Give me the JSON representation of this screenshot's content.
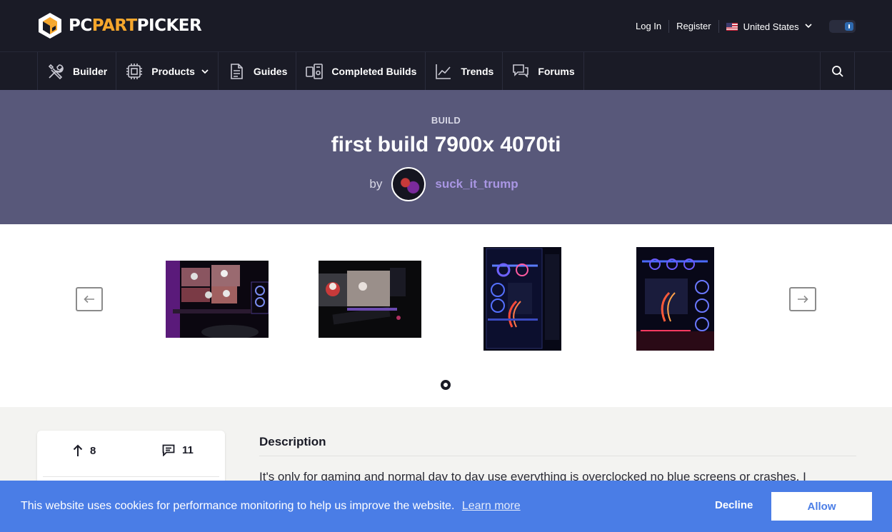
{
  "header": {
    "logo_prefix": "PC",
    "logo_accent": "PART",
    "logo_suffix": "PICKER",
    "login": "Log In",
    "register": "Register",
    "country": "United States"
  },
  "nav": {
    "items": [
      {
        "label": "Builder",
        "icon": "builder-tools-icon"
      },
      {
        "label": "Products",
        "icon": "cpu-chip-icon",
        "has_dropdown": true
      },
      {
        "label": "Guides",
        "icon": "document-icon"
      },
      {
        "label": "Completed Builds",
        "icon": "completed-builds-icon"
      },
      {
        "label": "Trends",
        "icon": "trend-chart-icon"
      },
      {
        "label": "Forums",
        "icon": "chat-bubbles-icon"
      }
    ],
    "search_icon": "search-icon"
  },
  "hero": {
    "eyebrow": "BUILD",
    "title": "first build 7900x 4070ti",
    "by": "by",
    "author": "suck_it_trump"
  },
  "gallery": {
    "prev_icon": "arrow-left-icon",
    "next_icon": "arrow-right-icon",
    "photos": [
      "desk-setup-photo-1",
      "desk-setup-photo-2",
      "case-interior-photo-1",
      "case-interior-photo-2"
    ],
    "active_page": 1
  },
  "stats": {
    "upvotes": "8",
    "comments": "11"
  },
  "description": {
    "heading": "Description",
    "text": "It's only for gaming and normal day to day use everything is overclocked no blue screens or crashes. I"
  },
  "cookie": {
    "message": "This website uses cookies for performance monitoring to help us improve the website.",
    "learn_more": "Learn more",
    "decline": "Decline",
    "allow": "Allow"
  },
  "colors": {
    "topbar": "#1a1b26",
    "hero": "#58587a",
    "logo_accent": "#f6a72d",
    "author": "#a996e3",
    "cookie": "#4a7de6"
  }
}
